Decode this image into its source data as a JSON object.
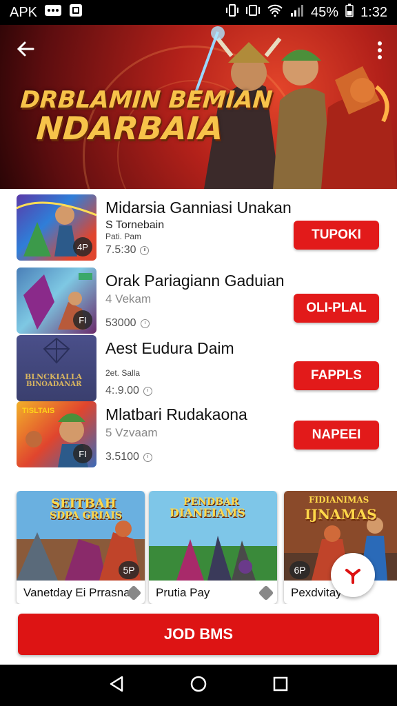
{
  "status_bar": {
    "carrier": "APK",
    "battery": "45%",
    "time": "1:32"
  },
  "hero": {
    "title_line1": "DRBLAMIN BEMIAN",
    "title_line2": "NDARBAIA"
  },
  "games": [
    {
      "title": "Midarsia Ganniasi Unakan",
      "subtitle": "S Tornebain",
      "meta": "Pati. Pam",
      "price": "7.5:30",
      "badge": "4P",
      "action": "TUPOKI"
    },
    {
      "title": "Orak Pariagiann Gaduian",
      "subtitle": "4 Vekam",
      "meta": "",
      "price": "53000",
      "badge": "FI",
      "action": "OLI-PLAL"
    },
    {
      "title": "Aest Eudura Daim",
      "subtitle": "",
      "meta": "2et. Salla",
      "price": "4:.9.00",
      "badge": "",
      "action": "FAPPLS",
      "thumb_text_1": "BLNCKIALLA",
      "thumb_text_2": "BINOADANAR"
    },
    {
      "title": "Mlatbari Rudakaona",
      "subtitle": "5 Vzvaam",
      "meta": "",
      "price": "3.5100",
      "badge": "FI",
      "action": "NAPEEI",
      "thumb_text_1": "TISLTAIS"
    }
  ],
  "cards": [
    {
      "caption": "Vanetday Ei Prrasna",
      "art_title_1": "SEITBAH",
      "art_title_2": "SDPA GRIAIS",
      "badge": "5P"
    },
    {
      "caption": "Prutia Pay",
      "art_title_1": "PENDBAR",
      "art_title_2": "DIANEIAMS"
    },
    {
      "caption": "Pexdvitay",
      "art_title_1": "FIDIANIMAS",
      "art_title_2": "IJNAMAS",
      "badge": "6P"
    }
  ],
  "primary_button": "JOD BMS",
  "colors": {
    "accent": "#e21a1a",
    "hero_bg": "#b3211a"
  }
}
